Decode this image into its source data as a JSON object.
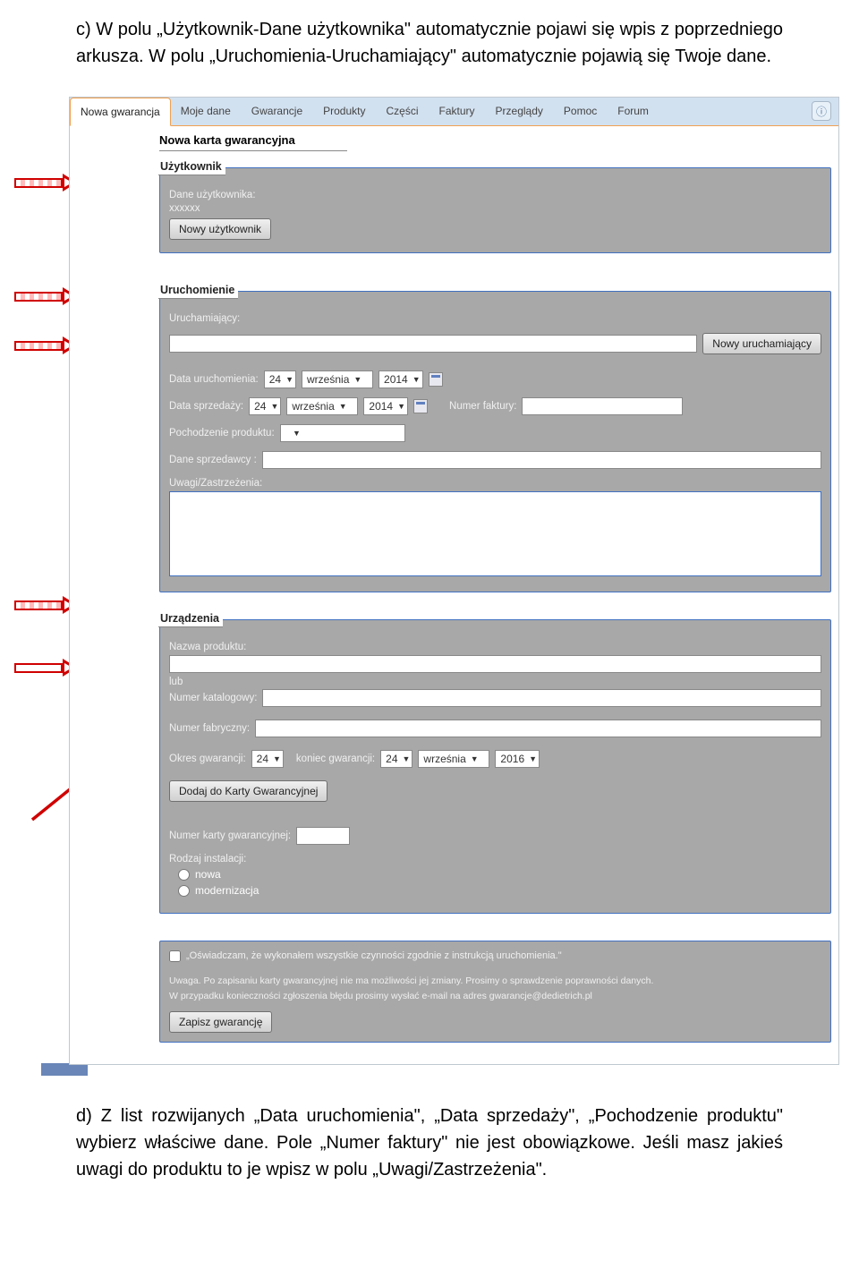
{
  "intro": {
    "part1": "c) W polu „Użytkownik-Dane użytkownika\" automatycznie pojawi się wpis z poprzedniego arkusza. W polu „Uruchomienia-Uruchamiający\" automatycznie pojawią się Twoje dane."
  },
  "tabs": {
    "t0": "Nowa gwarancja",
    "t1": "Moje dane",
    "t2": "Gwarancje",
    "t3": "Produkty",
    "t4": "Części",
    "t5": "Faktury",
    "t6": "Przeglądy",
    "t7": "Pomoc",
    "t8": "Forum"
  },
  "help_icon": "ⓘ",
  "page_title": "Nowa karta gwarancyjna",
  "user_panel": {
    "heading": "Użytkownik",
    "label_data": "Dane użytkownika:",
    "value_data": "xxxxxx",
    "btn_new": "Nowy użytkownik"
  },
  "launch_panel": {
    "heading": "Uruchomienie",
    "label_uruch": "Uruchamiający:",
    "btn_new": "Nowy uruchamiający",
    "label_data_uruch": "Data uruchomienia:",
    "day1": "24",
    "month1": "września",
    "year1": "2014",
    "label_data_sprz": "Data sprzedaży:",
    "day2": "24",
    "month2": "września",
    "year2": "2014",
    "label_faktura": "Numer faktury:",
    "label_pochodzenie": "Pochodzenie produktu:",
    "label_sprzedawca": "Dane sprzedawcy :",
    "label_uwagi": "Uwagi/Zastrzeżenia:"
  },
  "device_panel": {
    "heading": "Urządzenia",
    "label_produkt": "Nazwa produktu:",
    "lub": "lub",
    "label_katalog": "Numer katalogowy:",
    "label_fabryczny": "Numer fabryczny:",
    "label_okres": "Okres gwarancji:",
    "okres_val": "24",
    "label_koniec": "koniec gwarancji:",
    "day3": "24",
    "month3": "września",
    "year3": "2016",
    "btn_dodaj": "Dodaj do Karty Gwarancyjnej",
    "label_numer_karty": "Numer karty gwarancyjnej:",
    "label_rodzaj": "Rodzaj instalacji:",
    "radio_nowa": "nowa",
    "radio_modern": "modernizacja"
  },
  "declaration": {
    "text": "„Oświadczam, że wykonałem wszystkie czynności zgodnie z instrukcją uruchomienia.\"",
    "note1": "Uwaga. Po zapisaniu karty gwarancyjnej nie ma możliwości jej zmiany. Prosimy o sprawdzenie poprawności danych.",
    "note2": "W przypadku konieczności zgłoszenia błędu prosimy wysłać e-mail na adres gwarancje@dedietrich.pl",
    "btn_save": "Zapisz gwarancję"
  },
  "outro": {
    "text": "d) Z list rozwijanych „Data uruchomienia\", „Data sprzedaży\", „Pochodzenie produktu\" wybierz właściwe dane. Pole „Numer faktury\" nie jest obowiązkowe. Jeśli masz jakieś uwagi do produktu to je wpisz w polu „Uwagi/Zastrzeżenia\"."
  }
}
